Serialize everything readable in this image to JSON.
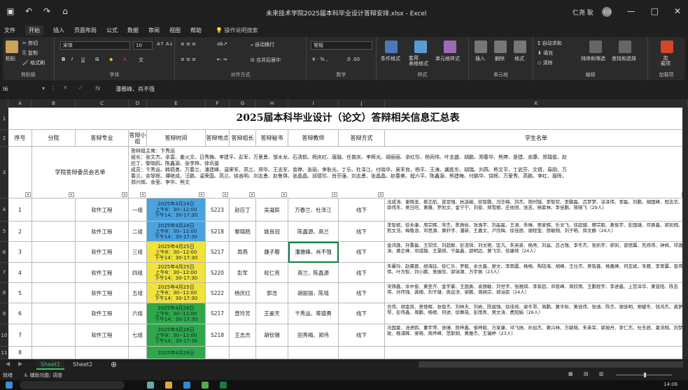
{
  "window": {
    "title": "未来技术学院2025届本科毕业设计答辩安排.xlsx - Excel",
    "user": "仁尧 耿",
    "autosave_icon": "save-icon"
  },
  "ribbon_tabs": [
    "文件",
    "开始",
    "插入",
    "页面布局",
    "公式",
    "数据",
    "审阅",
    "视图",
    "帮助"
  ],
  "ribbon_search": "操作说明搜索",
  "ribbon": {
    "clipboard": {
      "paste": "粘贴",
      "cut": "剪切",
      "copy": "复制",
      "format_painter": "格式刷",
      "label": "剪贴板"
    },
    "font": {
      "name": "宋体",
      "size": "10",
      "label": "字体"
    },
    "alignment": {
      "wrap": "自动换行",
      "merge": "合并后居中",
      "label": "对齐方式"
    },
    "number": {
      "format": "常规",
      "label": "数字"
    },
    "styles": {
      "conditional": "条件格式",
      "table": "套用\n表格格式",
      "cell": "单元格样式",
      "label": "样式"
    },
    "cells": {
      "insert": "插入",
      "delete": "删除",
      "format": "格式",
      "label": "单元格"
    },
    "editing": {
      "autosum": "自动求和",
      "fill": "填充",
      "clear": "清除",
      "sort": "排序和筛选",
      "find": "查找和选择",
      "label": "编辑"
    },
    "addins": {
      "load": "加\n载项",
      "label": "加载项"
    }
  },
  "formula_bar": {
    "name_box": "I6",
    "fx": "fx",
    "formula": "潘雅峰、肖不强"
  },
  "columns": [
    "A",
    "B",
    "C",
    "D",
    "E",
    "F",
    "G",
    "H",
    "I",
    "J",
    "K"
  ],
  "sheet_title": "2025届本科毕业设计（论文）答辩相关信息汇总表",
  "headers": [
    "序号",
    "分院",
    "答辩专业",
    "答辩小组",
    "答辩时间",
    "答辩地点",
    "答辩组长",
    "答辩秘书",
    "答辩教师",
    "答辩方式",
    "学生名单"
  ],
  "committee": {
    "label": "学院答辩委员会名单",
    "members": "答辩组主席：卞秀运\n组长：张文杰、余富、姜火文、日秀梅、李建平、彭军、万里勇、邹水龙、石清鹤、杨庆红、唐融、任普庆、李辉光、胡丽丽、余红珍、杨同伟、叶志盛、胡鹏、郑春华、熊婷、是建、余康、郑瑞俊、赵\n应丁、黎晓鸥、陈鑫源、张学林、徐讯骏\n成员：卞秀运、韩德勇、万春兰、潘建峰、温荣军、高兰、郑华、王志军、曾婷、张丽、李耿光、丁乐、杜泽江、付晓华、吴军良、杨平、王涛、龚胜东、胡瑞、刘燕、熊文平、丁武芬、文倩、易刚、万\n春兰、余琴辉、谭继成、汪鹏、温荣国、高兰、徐善明、刘志勇、赵鲁琪、张晶晶、邱德珍、肖芬强、刘志勇、张晶晶、赵春美、程六平、陈鑫源、熊建梅、付鹏华、饶辉、万爱秀、高鹏、李红、聂晖、\n郑兴辉、余莹、李华、熊文"
  },
  "rows": [
    {
      "row": "4",
      "no": "1",
      "major": "软件工程",
      "group": "一组",
      "date": "2025年4月24日",
      "am": "上午8：30--12:00",
      "pm": "下午14：30-17:30",
      "color": "#4aa3df",
      "room": "S223",
      "leader": "赵应丁",
      "secretary": "吴凝辰",
      "teachers": "万春兰、杜泽江",
      "mode": "线下",
      "students": "沈成涛、谢晓龙、蔡正航、曾亚强、杭凌磁、徐智鹏、冯华梅、刘杰、熊时铖、李智钦、李鹏磊、吕梦梦、涂泽伟、李磊、刘鹏、胡国峰、程志华、郎伟东、吴日旺、黄隆、罗凯文、金宁宁、刘俊、郑雪丽、庄依阳、张志、杨紫林、李佳鹏、熊晓飞（29人）"
    },
    {
      "row": "5",
      "no": "2",
      "major": "软件工程",
      "group": "二组",
      "date": "2025年4月24日",
      "am": "上午8：30--12:00",
      "pm": "下午14：30-17:30",
      "color": "#4aa3df",
      "room": "S218",
      "leader": "黎晓鸥",
      "secretary": "姚良冠",
      "teachers": "陈鑫源、高兰",
      "mode": "线下",
      "students": "李智斌、徐永康、周宗辉、宋杰、陈扬标、张逸宇、刘晶磊、王涵、朱琳、吴家辉、乐文飞、徐超健、穆宗毅、黄俊宇、彭国雄、邓勇鑫、郭凯翔、熊文浩、梅敬浪、邓思源、黄轩宇、潘新、王嘉文、卢欣梅、徐佳辰、谢程宝、熊敏翔、刘子皓、邱文静（29人）"
    },
    {
      "row": "6",
      "no": "3",
      "major": "软件工程",
      "group": "三组",
      "date": "2025年4月25日",
      "am": "上午8：30--12:00",
      "pm": "下午14：30-17:30",
      "color": "#f2e23a",
      "room": "S217",
      "leader": "周燕",
      "secretary": "魏子謄",
      "teachers": "潘雅峰、肖不强",
      "mode": "线下",
      "students": "金鸿逸、孙重磊、王钦欣、刘超群、彭泥祥、刘文艳、匡凡、朱英泉、杨亮、刘晶、吕占强、李冬杰、张凯宇、郭凯、曾德翼、先纬伟、钟佩、邓逸涛、黄正峰、邓成翰、王灏琪、宁磊鑫、邵明远、黄飞华、徐康琦（24人）"
    },
    {
      "row": "7",
      "no": "4",
      "major": "软件工程",
      "group": "四组",
      "date": "2025年4月25日",
      "am": "上午8：30--12:00",
      "pm": "下午14：30-17:30",
      "color": "#f2e23a",
      "room": "S220",
      "leader": "彭军",
      "secretary": "权仁亮",
      "teachers": "高兰、陈鑫源",
      "mode": "线下",
      "students": "朱曼玲、赵晨蓉、胡海廷、徐仁乐、罗毅、余文鑫、廖文、李雨霞、杨杨、陶钰海、胡峰、王仕杰、吴智鑫、杨嘉峰、何志斌、朱雁、李育翼、曾伟伟、叶为智、刘小鹏、吴振欣、郭诗源、万宇佩（23人）"
    },
    {
      "row": "8",
      "no": "5",
      "major": "软件工程",
      "group": "五组",
      "date": "2025年4月25日",
      "am": "上午8：30--12:00",
      "pm": "下午14：30-17:30",
      "color": "#f2e23a",
      "room": "S222",
      "leader": "杨庆红",
      "secretary": "郭浩",
      "teachers": "胡丽丽、陈瑶",
      "mode": "线下",
      "students": "宋铮鑫、余中俊、黄至齐、金宇豪、王国勇、袁丽敏、刘世宇、张雅琪、李家超、邓俊峰、周欣雨、王鹏程宇、李进鑫、上官泽华、黄宣阳、陈志伟、孙传强、龚楠、刘子雄、周远洋、梁鹏、周扬宗、郭治民（24人）"
    },
    {
      "row": "9",
      "no": "6",
      "major": "软件工程",
      "group": "六组",
      "date": "2025年4月26日",
      "am": "上午8：30--12:00",
      "pm": "下午14：30-17:30",
      "color": "#2ea84a",
      "room": "S217",
      "leader": "曾玲芳",
      "secretary": "王晏天",
      "teachers": "卞秀运、蒋德勇",
      "mode": "线下",
      "students": "肖伟、胡金凯、吴德辉、张俊杰、刘林夫、刘岩、陈骏强、徐佳琦、梁冬哥、周鹏、黄平秋、黄佳伟、张涵、陈杰、谢佳明、郑媛冬、钱鸿杰、龚萝琴、彭伟鑫、周鹏、杨德、何进、徐舞苑、彭雨秀、吴文涛、费冠娟（26人）"
    },
    {
      "row": "10",
      "no": "7",
      "major": "软件工程",
      "group": "七组",
      "date": "2025年4月26日",
      "am": "上午8：30--12:00",
      "pm": "下午14：30-17:30",
      "color": "#2ea84a",
      "room": "S218",
      "leader": "王志杰",
      "secretary": "胡钦锡",
      "teachers": "田秀梅、郑伟",
      "mode": "线下",
      "students": "冯国夏、汤贤鸥、董宇萍、张珊、熊梓鑫、邹梓毅、万家康、邓飞扬、孙加杰、黄兴林、方毓晓、朱英军、郭旭舟、李仁杰、杜东辰、夏浏翔、刘梦玫、杨浦辉、梁晓、周烨峰、范斯刚、黄雅杰、王瑞婷（23人）"
    },
    {
      "row": "11",
      "no": "8",
      "major": "",
      "group": "",
      "date": "2025年4月26日",
      "am": "",
      "pm": "",
      "color": "#2ea84a",
      "room": "",
      "leader": "",
      "secretary": "",
      "teachers": "",
      "mode": "",
      "students": ""
    }
  ],
  "sheet_tabs": [
    "Sheet1",
    "Sheet2"
  ],
  "status": {
    "ready": "就绪",
    "accessibility": "辅助功能: 调查",
    "zoom": "100%"
  },
  "clock": "14:06"
}
